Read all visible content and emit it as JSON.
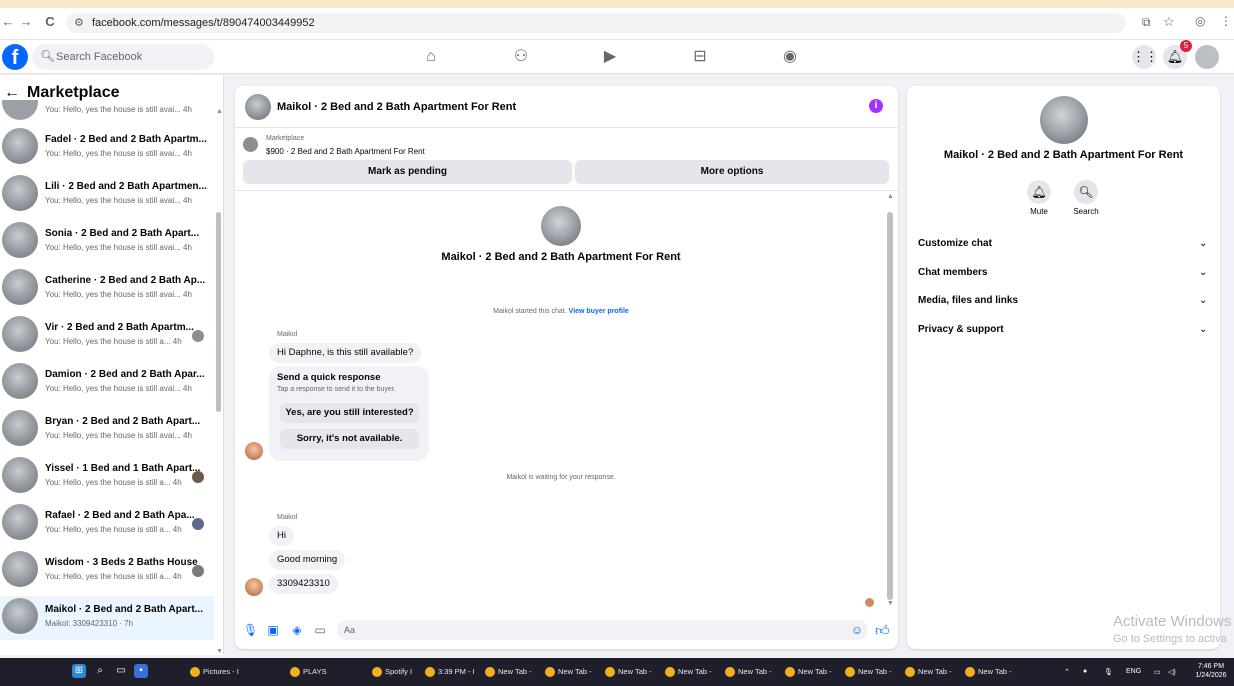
{
  "browser": {
    "url": "facebook.com/messages/t/8904740034499​52",
    "nav_back": "←",
    "nav_forward": "→",
    "nav_reload": "C"
  },
  "fb": {
    "logo": "f",
    "search_placeholder": "Search Facebook",
    "notification_count": "5"
  },
  "sidebar": {
    "title": "Marketplace",
    "partial_top_sub": "You: Hello, yes the house is still avai...  4h",
    "conversations": [
      {
        "title": "Fadel · 2 Bed and 2 Bath Apartm...",
        "sub": "You: Hello, yes the house is still avai...  4h"
      },
      {
        "title": "Lili · 2 Bed and 2 Bath Apartmen...",
        "sub": "You: Hello, yes the house is still avai...  4h"
      },
      {
        "title": "Sonia · 2 Bed and 2 Bath Apart...",
        "sub": "You: Hello, yes the house is still avai...  4h"
      },
      {
        "title": "Catherine · 2 Bed and 2 Bath Ap...",
        "sub": "You: Hello, yes the house is still avai...  4h"
      },
      {
        "title": "Vir · 2 Bed and 2 Bath Apartm...",
        "sub": "You: Hello, yes the house is still a...  4h"
      },
      {
        "title": "Damion · 2 Bed and 2 Bath Apar...",
        "sub": "You: Hello, yes the house is still avai...  4h"
      },
      {
        "title": "Bryan · 2 Bed and 2 Bath Apart...",
        "sub": "You: Hello, yes the house is still avai...  4h"
      },
      {
        "title": "Yissel · 1 Bed and 1 Bath Apart...",
        "sub": "You: Hello, yes the house is still a...  4h"
      },
      {
        "title": "Rafael · 2 Bed and 2 Bath Apa...",
        "sub": "You: Hello, yes the house is still a...  4h"
      },
      {
        "title": "Wisdom · 3 Beds 2 Baths House",
        "sub": "You: Hello, yes the house is still a...  4h"
      },
      {
        "title": "Maikol · 2 Bed and 2 Bath Apart...",
        "sub": "Maikol: 3309423310 · 7h"
      }
    ]
  },
  "chat": {
    "title": "Maikol · 2 Bed and 2 Bath Apartment For Rent",
    "info_icon": "i",
    "marketplace_label": "Marketplace",
    "listing": "$900 · 2 Bed and 2 Bath Apartment For Rent",
    "mark_pending": "Mark as pending",
    "more_options": "More options",
    "center_title": "Maikol · 2 Bed and 2 Bath Apartment For Rent",
    "started_text": "Maikol started this chat.",
    "view_profile": "View buyer profile",
    "sender": "Maikol",
    "msg1": "Hi Daphne, is this still available?",
    "quick_title": "Send a quick response",
    "quick_sub": "Tap a response to send it to the buyer.",
    "quick1": "Yes, are you still interested?",
    "quick2": "Sorry, it's not available.",
    "waiting": "Maikol is waiting for your response.",
    "sender2": "Maikol",
    "msg2": "Hi",
    "msg3": "Good morning",
    "msg4": "3309423310",
    "composer_placeholder": "Aa"
  },
  "right": {
    "title": "Maikol · 2 Bed and 2 Bath Apartment For Rent",
    "mute": "Mute",
    "search": "Search",
    "items": [
      "Customize chat",
      "Chat members",
      "Media, files and links",
      "Privacy & support"
    ]
  },
  "watermark": {
    "line1": "Activate Windows",
    "line2": "Go to Settings to activa"
  },
  "taskbar": {
    "items": [
      "Pictures - I",
      "PLAYS",
      "Spotify I",
      "3:39 PM - I",
      "New Tab -",
      "New Tab -",
      "New Tab -",
      "New Tab -",
      "New Tab -",
      "New Tab -",
      "New Tab -",
      "New Tab -",
      "New Tab -"
    ],
    "lang": "ENG",
    "time": "7:46 PM",
    "date": "1/24/2026"
  }
}
